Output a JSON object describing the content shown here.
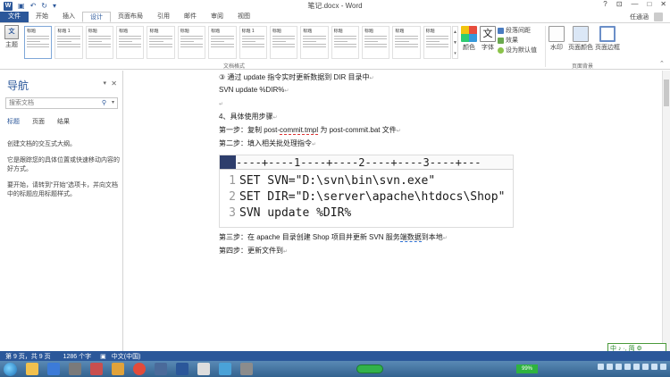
{
  "window": {
    "title": "笔记.docx - Word",
    "controls": [
      "?",
      "⊡",
      "—",
      "□",
      "✕"
    ]
  },
  "ribbon_tabs": [
    "文件",
    "开始",
    "插入",
    "设计",
    "页面布局",
    "引用",
    "邮件",
    "审阅",
    "视图"
  ],
  "active_tab": "设计",
  "user": {
    "name": "任通涵"
  },
  "ribbon": {
    "theme_label": "主题",
    "style_thumbs": [
      "标题",
      "标题 1",
      "标题",
      "标题",
      "标题",
      "标题",
      "标题",
      "标题 1",
      "标题",
      "标题",
      "标题",
      "标题",
      "标题",
      "标题"
    ],
    "group_doc_format": "文档格式",
    "colors_label": "颜色",
    "fonts_label": "字体",
    "para_spacing": "段落间距",
    "effects": "效果",
    "set_default": "设为默认值",
    "watermark": "水印",
    "page_color": "页面颜色",
    "page_border": "页面边框",
    "group_page_bg": "页面背景"
  },
  "nav": {
    "title": "导航",
    "search_placeholder": "搜索文档",
    "tabs": [
      "标题",
      "页面",
      "结果"
    ],
    "text1": "创建文档的交互式大纲。",
    "text2": "它是跟踪您的具体位置或快速移动内容的好方式。",
    "text3": "要开始，请转到\"开始\"选项卡，并向文档中的标题应用标题样式。"
  },
  "doc": {
    "l1": "③  通过 update 指令实时更新数据到 DIR 目录中",
    "l2": "SVN update %DIR%",
    "l3": "4、具体使用步骤",
    "l4_a": "第一步：复制 post-",
    "l4_b": "commit.tmpl",
    "l4_c": " 为 post-commit.bat 文件",
    "l5": "第二步：填入相关批处理指令",
    "ruler": "----+----1----+----2----+----3----+---",
    "code": [
      {
        "n": "1",
        "t": "SET SVN=\"D:\\svn\\bin\\svn.exe\""
      },
      {
        "n": "2",
        "t": "SET DIR=\"D:\\server\\apache\\htdocs\\Shop\""
      },
      {
        "n": "3",
        "t": "SVN update %DIR%"
      }
    ],
    "l6_a": "第三步：在 apache 目录创建 Shop 项目并更新 SVN 服务",
    "l6_b": "端数据",
    "l6_c": "到本地",
    "l7": "第四步：更新文件到"
  },
  "status": {
    "page": "第 9 页，共 9 页",
    "words": "1286 个字",
    "lang": "中文(中国)"
  },
  "taskbar": {
    "battery": "99%"
  },
  "ime": "中 ♪ ·, 简 ⚙"
}
